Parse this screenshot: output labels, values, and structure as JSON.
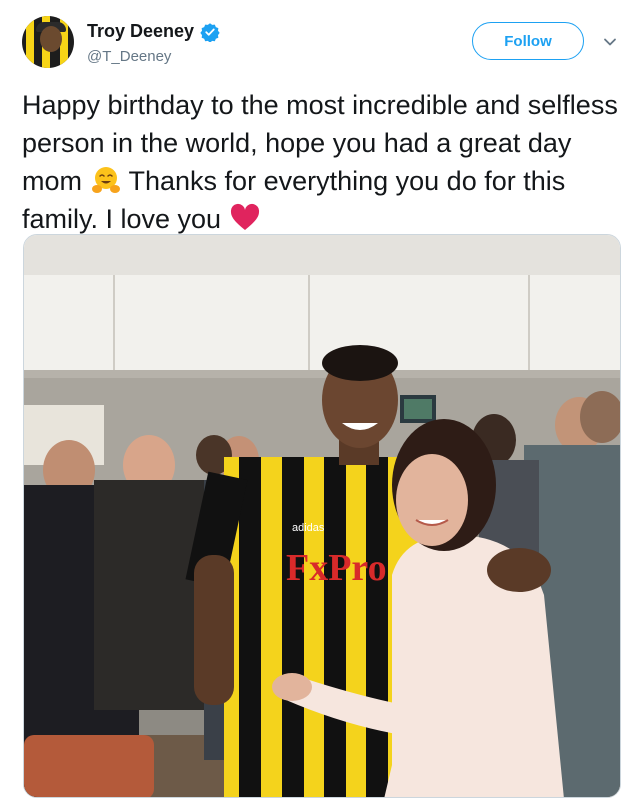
{
  "author": {
    "display_name": "Troy Deeney",
    "handle": "@T_Deeney",
    "verified": true,
    "avatar_icon": "profile-avatar"
  },
  "actions": {
    "follow_label": "Follow",
    "more_icon": "chevron-down-icon"
  },
  "tweet": {
    "text_part1": "Happy birthday to the most incredible and selfless person in the world, hope you had a great day mom ",
    "emoji1": "hugging-face-emoji",
    "text_part2": " Thanks for everything you do for this family. I love you ",
    "emoji2": "red-heart-emoji"
  },
  "media": {
    "shirt_sponsor": "FxPro",
    "kit_brand": "adidas"
  },
  "colors": {
    "brand_blue": "#1da1f2",
    "text_primary": "#14171a",
    "text_secondary": "#657786",
    "heart_red": "#e0245e",
    "kit_yellow": "#f4d31c"
  }
}
